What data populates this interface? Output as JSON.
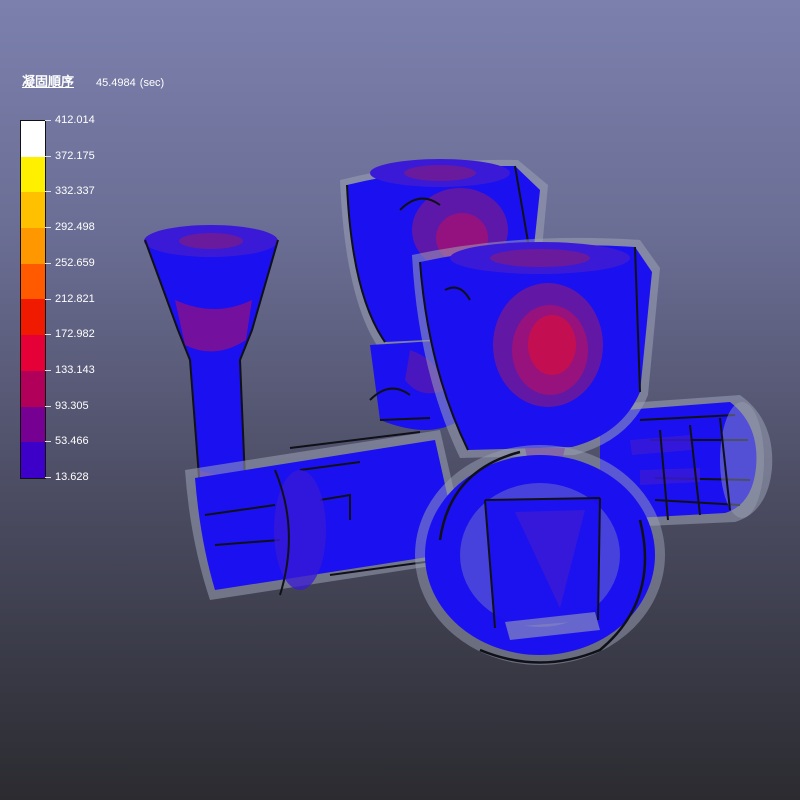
{
  "header": {
    "title": "凝固順序",
    "time_value": "45.4984",
    "time_unit": "(sec)"
  },
  "legend": {
    "labels": [
      "412.014",
      "372.175",
      "332.337",
      "292.498",
      "252.659",
      "212.821",
      "172.982",
      "133.143",
      "93.305",
      "53.466",
      "13.628"
    ],
    "colors": [
      "#ffffff",
      "#fff000",
      "#ffc000",
      "#ff9800",
      "#ff5a00",
      "#f01a00",
      "#e60038",
      "#b0005a",
      "#760092",
      "#3c00c8",
      "#0008f0"
    ]
  },
  "model": {
    "palette": {
      "shell": "#9aa0b4",
      "cold": "#1a10f0",
      "cool": "#3a1ad6",
      "mid": "#6a1a9c",
      "warm": "#9a127a",
      "hot": "#c8104c",
      "outline": "#101018"
    }
  }
}
